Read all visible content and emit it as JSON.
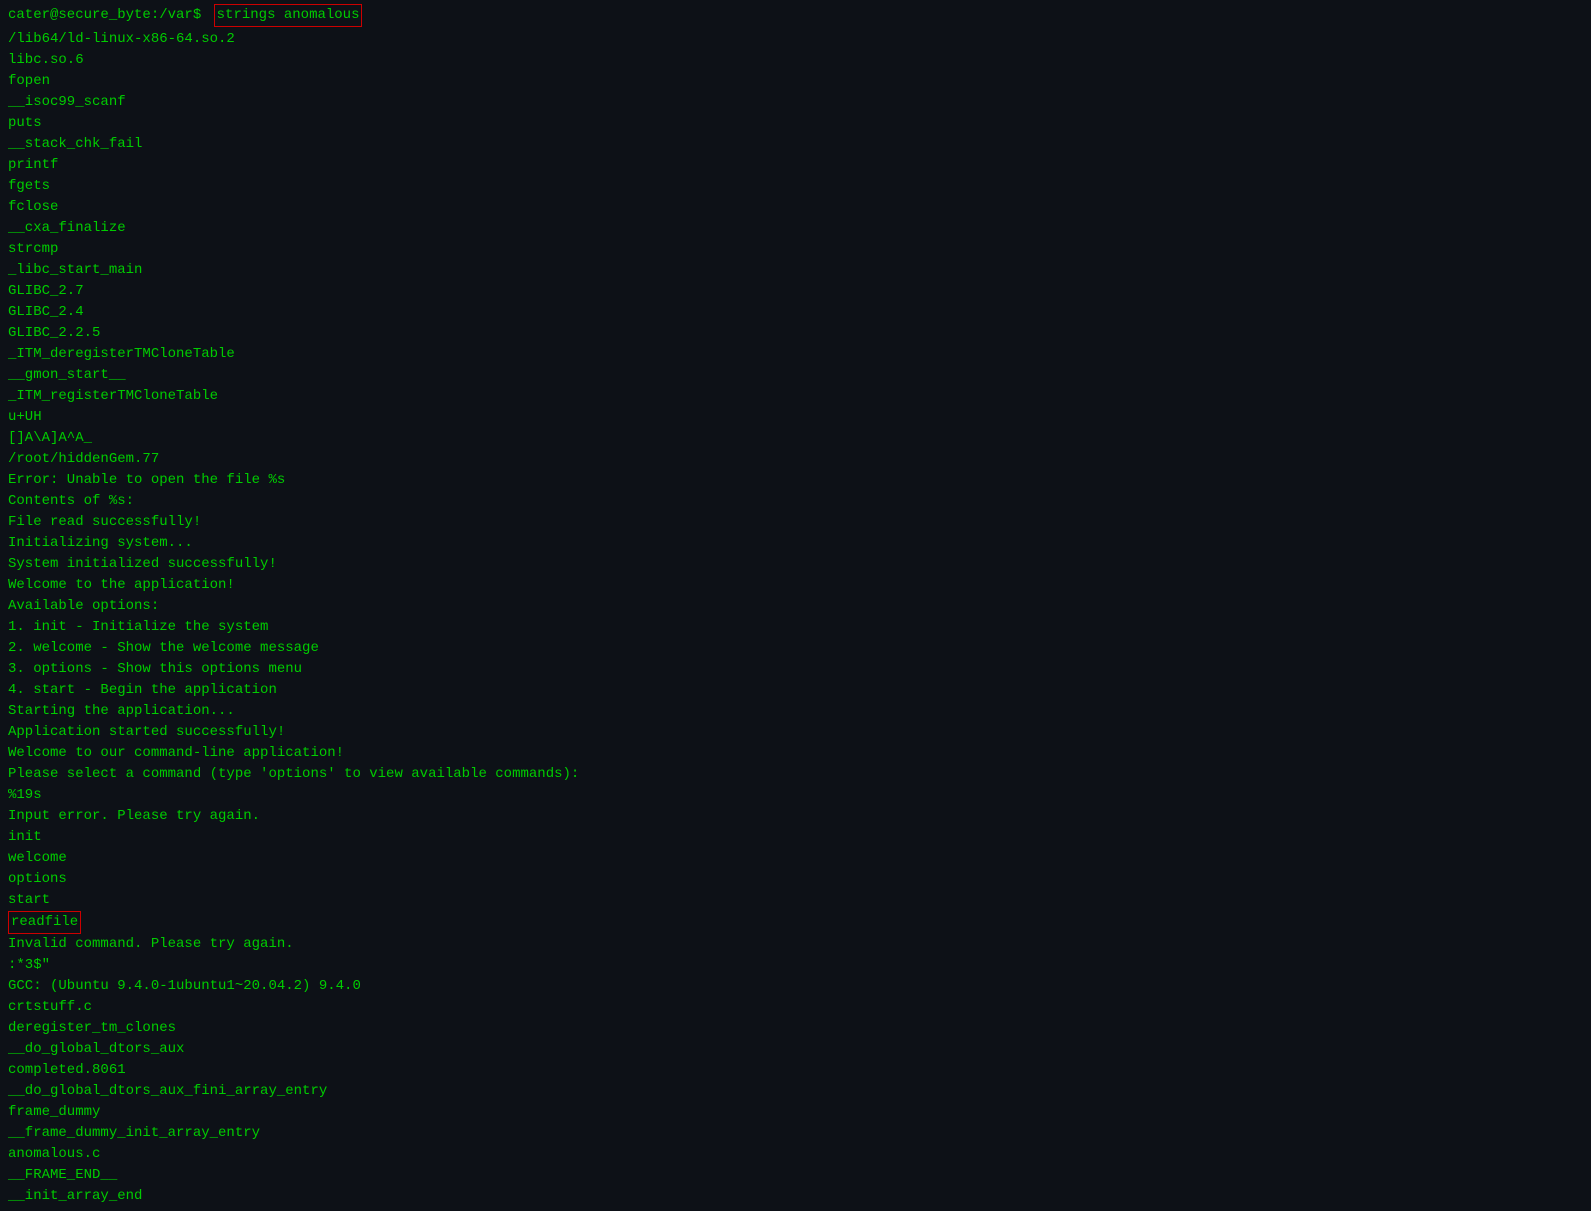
{
  "terminal": {
    "prompt": {
      "user": "cater@secure_byte",
      "path": ":/var$",
      "command": "strings anomalous"
    },
    "output_lines": [
      "/lib64/ld-linux-x86-64.so.2",
      "libc.so.6",
      "fopen",
      "__isoc99_scanf",
      "puts",
      "__stack_chk_fail",
      "printf",
      "fgets",
      "fclose",
      "__cxa_finalize",
      "strcmp",
      "_libc_start_main",
      "GLIBC_2.7",
      "GLIBC_2.4",
      "GLIBC_2.2.5",
      "_ITM_deregisterTMCloneTable",
      "__gmon_start__",
      "_ITM_registerTMCloneTable",
      "u+UH",
      "[]A\\A]A^A_",
      "/root/hiddenGem.77",
      "Error: Unable to open the file %s",
      "Contents of %s:",
      "File read successfully!",
      "Initializing system...",
      "System initialized successfully!",
      "Welcome to the application!",
      "Available options:",
      "1. init - Initialize the system",
      "2. welcome - Show the welcome message",
      "3. options - Show this options menu",
      "4. start - Begin the application",
      "Starting the application...",
      "Application started successfully!",
      "Welcome to our command-line application!",
      "Please select a command (type 'options' to view available commands):",
      "%19s",
      "Input error. Please try again.",
      "init",
      "welcome",
      "options",
      "start"
    ],
    "readfile_line": "readfile",
    "output_lines2": [
      "Invalid command. Please try again.",
      ":*3$\"",
      "GCC: (Ubuntu 9.4.0-1ubuntu1~20.04.2) 9.4.0",
      "crtstuff.c",
      "deregister_tm_clones",
      "__do_global_dtors_aux",
      "completed.8061",
      "__do_global_dtors_aux_fini_array_entry",
      "frame_dummy",
      "__frame_dummy_init_array_entry",
      "anomalous.c",
      "__FRAME_END__",
      "__init_array_end"
    ]
  }
}
